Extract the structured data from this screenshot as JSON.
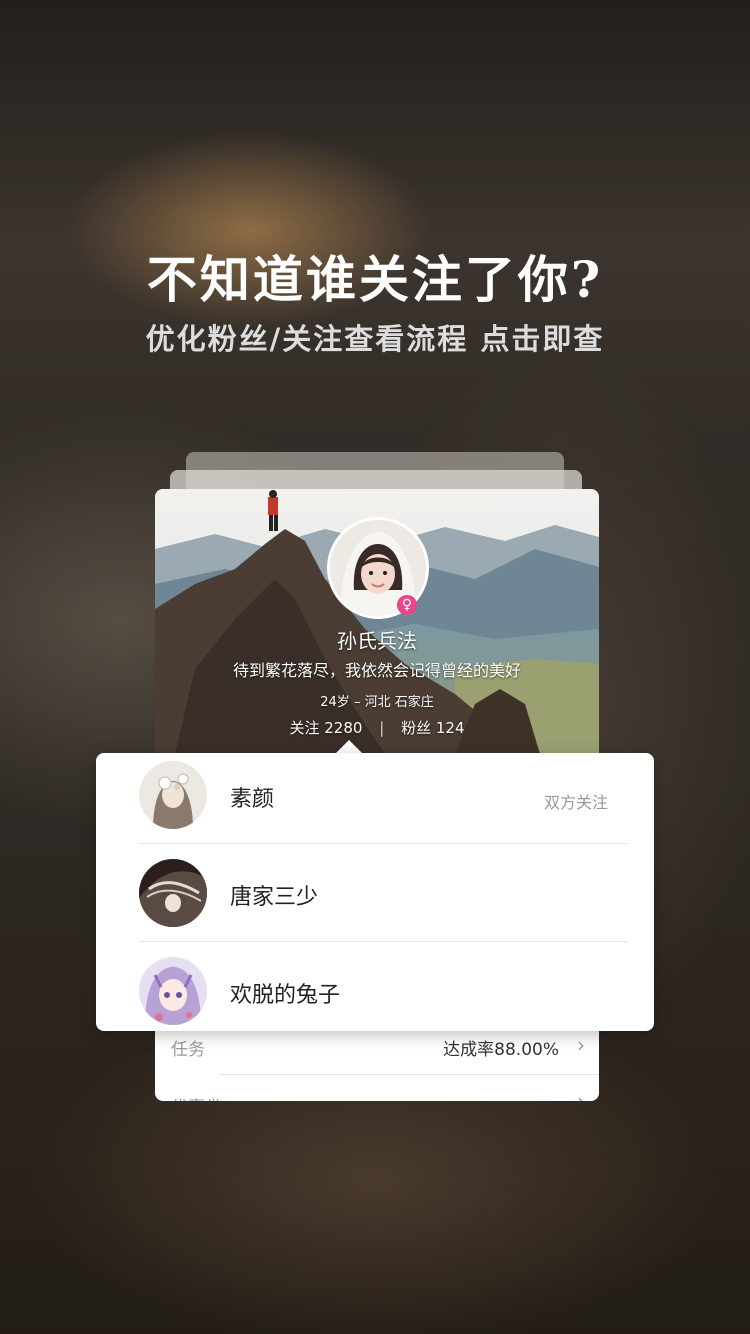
{
  "headline": "不知道谁关注了你?",
  "subline": "优化粉丝/关注查看流程 点击即查",
  "profile": {
    "name": "孙氏兵法",
    "bio": "待到繁花落尽，我依然会记得曾经的美好",
    "meta": "24岁 – 河北 石家庄",
    "following_label": "关注",
    "following_count": "2280",
    "fans_label": "粉丝",
    "fans_count": "124",
    "gender_symbol": "♀"
  },
  "task_row": {
    "label": "任务",
    "value": "达成率88.00%",
    "chevron": "›"
  },
  "cut_row": {
    "label": "优惠券",
    "chevron": "›"
  },
  "popup_list": [
    {
      "name": "素颜",
      "badge": "双方关注"
    },
    {
      "name": "唐家三少",
      "badge": ""
    },
    {
      "name": "欢脱的兔子",
      "badge": ""
    }
  ],
  "colors": {
    "gender_badge": "#e8458b"
  },
  "icons": {
    "chevron": "chevron-right-icon",
    "gender": "female-icon"
  }
}
